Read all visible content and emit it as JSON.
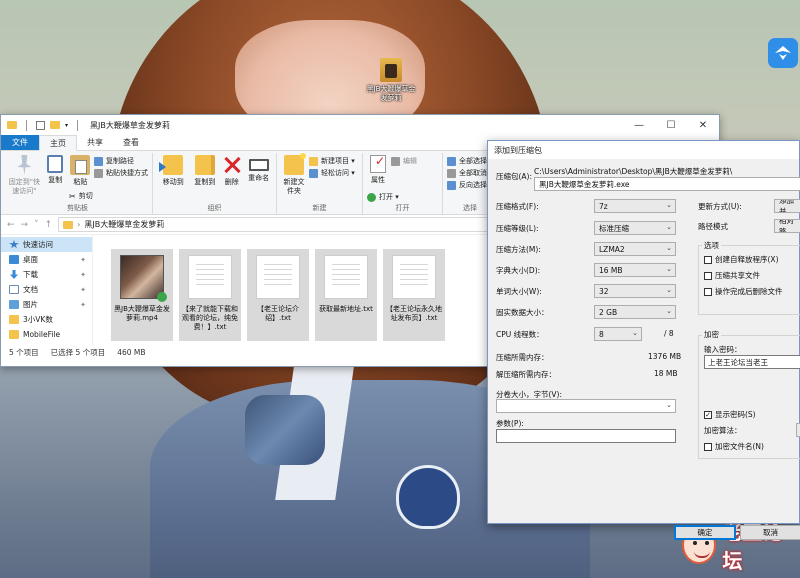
{
  "desktop": {
    "icon_label": "黑JB大鞭爆草金发萝莉",
    "watermark": "老王论坛"
  },
  "explorer": {
    "title": "黑JB大鞭爆草金发萝莉",
    "tabs": [
      "文件",
      "主页",
      "共享",
      "查看"
    ],
    "ribbon": {
      "clipboard": {
        "pin": "固定到\"快速访问\"",
        "copy": "复制",
        "paste": "粘贴",
        "copy_path": "复制路径",
        "paste_shortcut": "粘贴快捷方式",
        "cut": "剪切",
        "group": "剪贴板"
      },
      "organize": {
        "move_to": "移动到",
        "copy_to": "复制到",
        "delete": "删除",
        "rename": "重命名",
        "group": "组织"
      },
      "new": {
        "new_folder": "新建文件夹",
        "new_item": "新建项目 ▾",
        "easy_access": "轻松访问 ▾",
        "group": "新建"
      },
      "open": {
        "properties": "属性",
        "open": "打开 ▾",
        "edit": "编辑",
        "group": "打开"
      },
      "select": {
        "select_all": "全部选择",
        "select_none": "全部取消",
        "invert": "反向选择",
        "group": "选择"
      }
    },
    "address": {
      "path": "黑JB大鞭爆草金发萝莉"
    },
    "nav": [
      {
        "label": "快速访问"
      },
      {
        "label": "桌面"
      },
      {
        "label": "下载"
      },
      {
        "label": "文档"
      },
      {
        "label": "图片"
      },
      {
        "label": "3小VK数"
      },
      {
        "label": "MobileFile"
      }
    ],
    "files": [
      {
        "name": "黑JB大鞭爆草金发萝莉.mp4"
      },
      {
        "name": "【来了就能下载和观看的论坛，纯免费！】.txt"
      },
      {
        "name": "【老王论坛介绍】.txt"
      },
      {
        "name": "获取最新地址.txt"
      },
      {
        "name": "【老王论坛永久地址发布页】.txt"
      }
    ],
    "status": {
      "count": "5 个项目",
      "selected": "已选择 5 个项目",
      "size": "460 MB"
    }
  },
  "dialog": {
    "title": "添加到压缩包",
    "archive_label": "压缩包(A):",
    "archive_path": "C:\\Users\\Administrator\\Desktop\\黑JB大鞭爆草金发萝莉\\",
    "archive_name": "黑JB大鞭爆草金发萝莉.exe",
    "format_label": "压缩格式(F):",
    "format_value": "7z",
    "level_label": "压缩等级(L):",
    "level_value": "标准压缩",
    "method_label": "压缩方法(M):",
    "method_value": "LZMA2",
    "dict_label": "字典大小(D):",
    "dict_value": "16 MB",
    "word_label": "单词大小(W):",
    "word_value": "32",
    "solid_label": "固实数据大小：",
    "solid_value": "2 GB",
    "cpu_label": "CPU 线程数：",
    "cpu_value": "8",
    "cpu_total": "/ 8",
    "mem_compress_label": "压缩所需内存：",
    "mem_compress_value": "1376 MB",
    "mem_decompress_label": "解压缩所需内存：",
    "mem_decompress_value": "18 MB",
    "split_label": "分卷大小，字节(V):",
    "params_label": "参数(P):",
    "update_label": "更新方式(U):",
    "update_value": "添加并",
    "path_mode_label": "路径模式",
    "path_mode_value": "相对路",
    "options_title": "选项",
    "opt_sfx": "创建自释放程序(X)",
    "opt_shared": "压缩共享文件",
    "opt_delete": "操作完成后删除文件",
    "encrypt_title": "加密",
    "password_label": "输入密码：",
    "password_value": "上老王论坛当老王",
    "show_password": "显示密码(S)",
    "encrypt_method_label": "加密算法：",
    "encrypt_names": "加密文件名(N)",
    "ok": "确定",
    "cancel": "取消"
  }
}
